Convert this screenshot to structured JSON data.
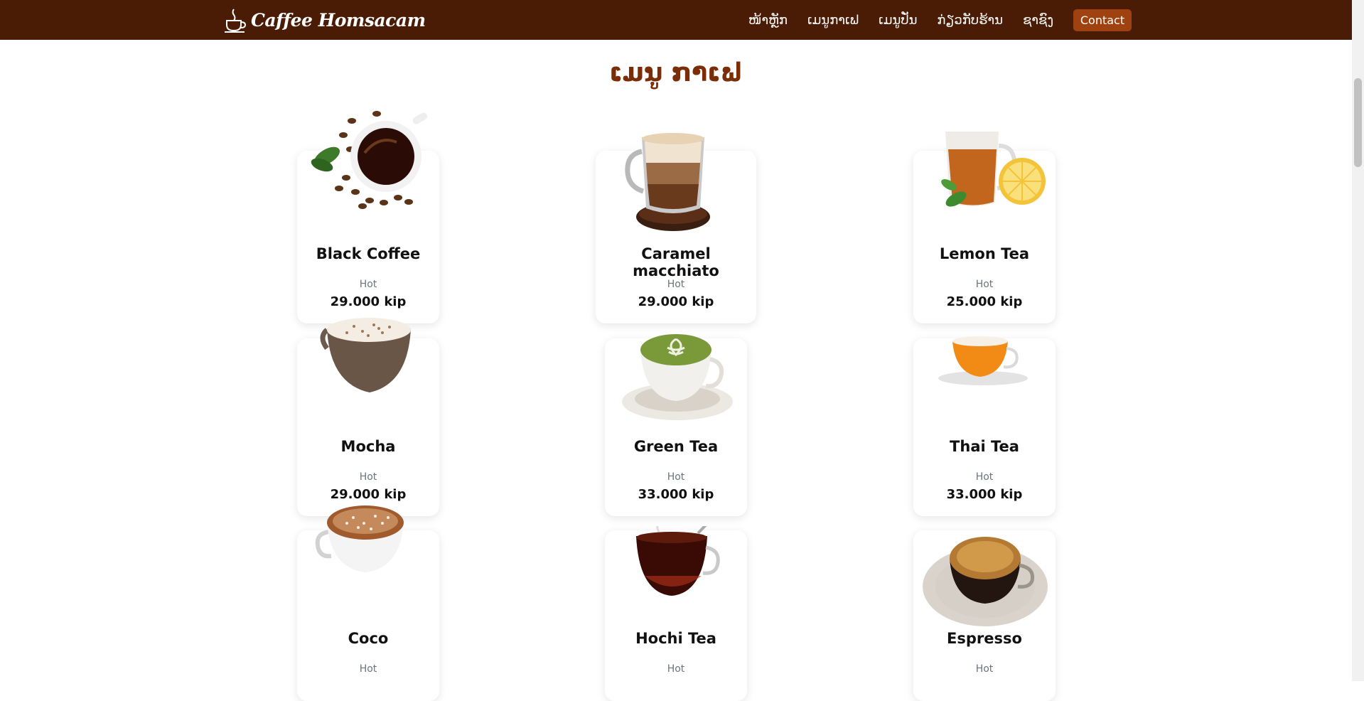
{
  "navbar": {
    "brand": "Caffee Homsacam",
    "links": [
      "ໜ້າຫຼັກ",
      "ເມນູກາເຟ",
      "ເມນູປັ່ນ",
      "ກ່ຽວກັບຮ້ານ",
      "ຊາຊົງ"
    ],
    "contact_label": "Contact"
  },
  "page": {
    "title": "ເມນູ ກາເຟ"
  },
  "menu_items": [
    {
      "name": "Black Coffee",
      "type": "Hot",
      "price": "29.000 kip"
    },
    {
      "name": "Caramel macchiato",
      "type": "Hot",
      "price": "29.000 kip"
    },
    {
      "name": "Lemon Tea",
      "type": "Hot",
      "price": "25.000 kip"
    },
    {
      "name": "Mocha",
      "type": "Hot",
      "price": "29.000 kip"
    },
    {
      "name": "Green Tea",
      "type": "Hot",
      "price": "33.000 kip"
    },
    {
      "name": "Thai Tea",
      "type": "Hot",
      "price": "33.000 kip"
    },
    {
      "name": "Coco",
      "type": "Hot"
    },
    {
      "name": "Hochi Tea",
      "type": "Hot"
    },
    {
      "name": "Espresso",
      "type": "Hot"
    }
  ],
  "colors": {
    "navbar_bg": "#4a1c06",
    "contact_bg": "#a0420f",
    "title": "#7a2d07"
  },
  "icons": {
    "brand": "coffee-cup-icon"
  }
}
